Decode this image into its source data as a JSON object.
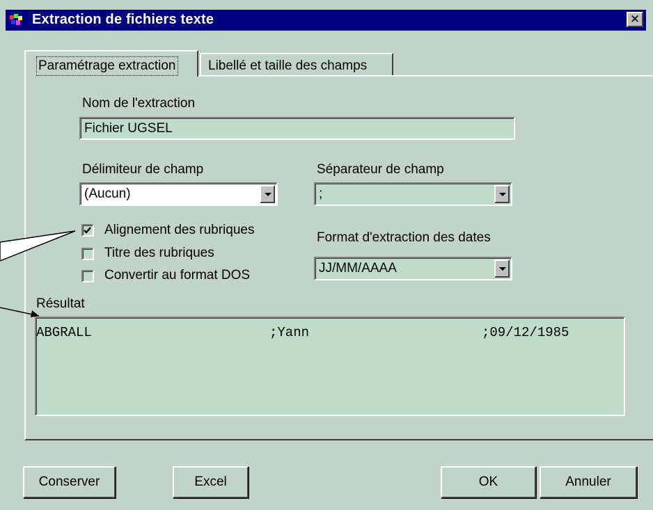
{
  "window": {
    "title": "Extraction de fichiers texte",
    "close_glyph": "✕"
  },
  "tabs": [
    {
      "label": "Paramétrage extraction",
      "active": true
    },
    {
      "label": "Libellé et taille des champs",
      "active": false
    }
  ],
  "form": {
    "name_label": "Nom de l'extraction",
    "name_value": "Fichier UGSEL",
    "delimiter_label": "Délimiteur de champ",
    "delimiter_value": "(Aucun)",
    "separator_label": "Séparateur de champ",
    "separator_value": ";",
    "date_format_label": "Format d'extraction des dates",
    "date_format_value": "JJ/MM/AAAA",
    "checkboxes": [
      {
        "label": "Alignement des rubriques",
        "checked": true
      },
      {
        "label": "Titre des rubriques",
        "checked": false
      },
      {
        "label": "Convertir au format DOS",
        "checked": false
      }
    ]
  },
  "result": {
    "label": "Résultat",
    "cells": [
      "ABGRALL",
      ";Yann",
      ";09/12/1985"
    ]
  },
  "buttons": {
    "save": "Conserver",
    "excel": "Excel",
    "ok": "OK",
    "cancel": "Annuler"
  },
  "icons": {
    "app": "colored-blocks-icon",
    "close": "close-icon",
    "dropdown": "chevron-down-icon",
    "check": "checkmark-icon"
  },
  "colors": {
    "title_bar": "#000080",
    "panel": "#c0d4c7",
    "field": "#bfdccb"
  }
}
